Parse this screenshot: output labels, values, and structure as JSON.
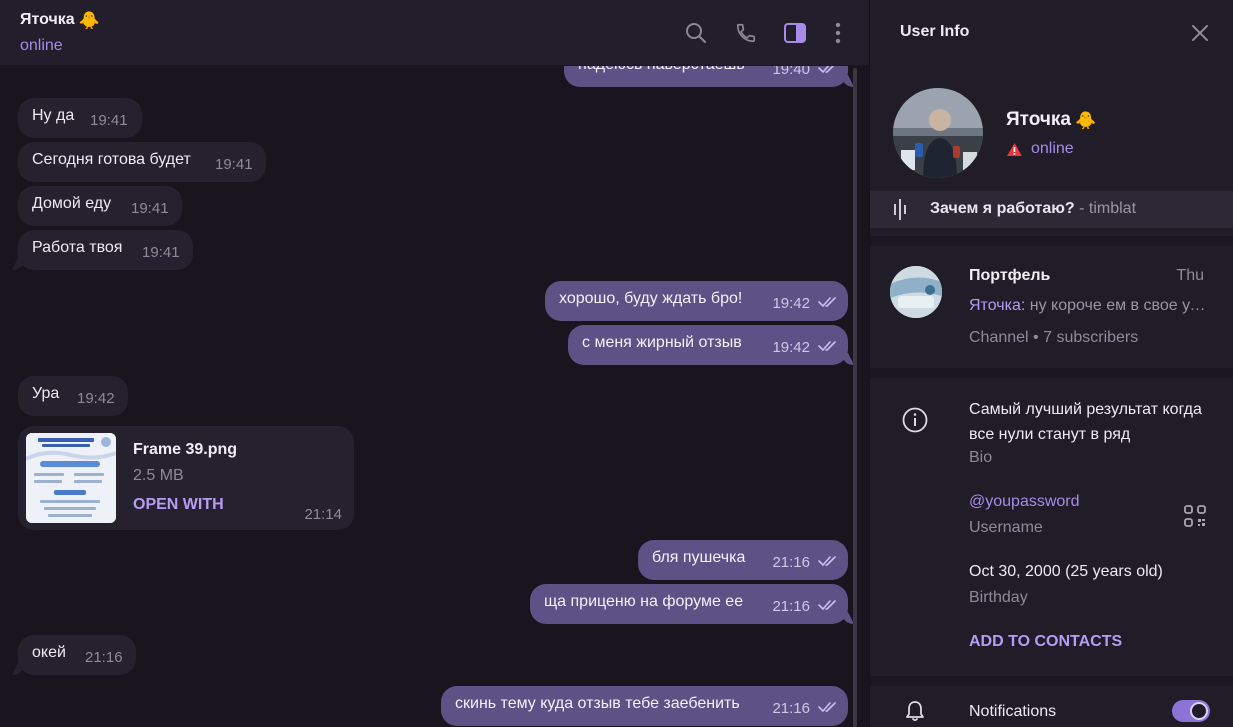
{
  "chat": {
    "title": "Яточка",
    "title_emoji": "🐥",
    "status": "online",
    "header_icons": [
      "search-icon",
      "phone-icon",
      "sidebar-toggle-icon",
      "more-vert-icon"
    ]
  },
  "messages": [
    {
      "dir": "out",
      "text": "надеюсь наверстаешь",
      "time": "19:40"
    },
    {
      "dir": "in",
      "text": "Ну да",
      "time": "19:41"
    },
    {
      "dir": "in",
      "text": "Сегодня готова будет",
      "time": "19:41"
    },
    {
      "dir": "in",
      "text": "Домой еду",
      "time": "19:41"
    },
    {
      "dir": "in",
      "text": "Работа твоя",
      "time": "19:41"
    },
    {
      "dir": "out",
      "text": "хорошо, буду ждать бро!",
      "time": "19:42"
    },
    {
      "dir": "out",
      "text": "с меня жирный отзыв",
      "time": "19:42"
    },
    {
      "dir": "in",
      "text": "Ура",
      "time": "19:42"
    },
    {
      "dir": "out",
      "text": "бля пушечка",
      "time": "21:16"
    },
    {
      "dir": "out",
      "text": "ща приценю на форуме ее",
      "time": "21:16"
    },
    {
      "dir": "in",
      "text": "окей",
      "time": "21:16"
    },
    {
      "dir": "out",
      "text": "скинь тему куда отзыв тебе заебенить",
      "time": "21:16"
    }
  ],
  "file": {
    "name": "Frame 39.png",
    "size": "2.5 MB",
    "action": "OPEN WITH",
    "time": "21:14"
  },
  "info": {
    "title": "User Info",
    "name": "Яточка",
    "name_emoji": "🐥",
    "status": "online",
    "music": {
      "title": "Зачем я работаю?",
      "artist": " - timblat"
    },
    "channel": {
      "name": "Портфель",
      "date": "Thu",
      "preview_author": "Яточка:",
      "preview_text": " ну короче ем в свое удовольствие",
      "meta": "Channel • 7 subscribers"
    },
    "bio": "Самый лучший результат когда все нули станут в ряд",
    "bio_label": "Bio",
    "username": "@youpassword",
    "username_label": "Username",
    "birthday": "Oct 30, 2000 (25 years old)",
    "birthday_label": "Birthday",
    "add_contacts": "ADD TO CONTACTS",
    "notifications_label": "Notifications",
    "notifications_on": true
  },
  "colors": {
    "accent": "#a68be8",
    "outgoing_bubble": "#5c5285",
    "incoming_bubble": "#26212f",
    "background": "#18151f"
  }
}
